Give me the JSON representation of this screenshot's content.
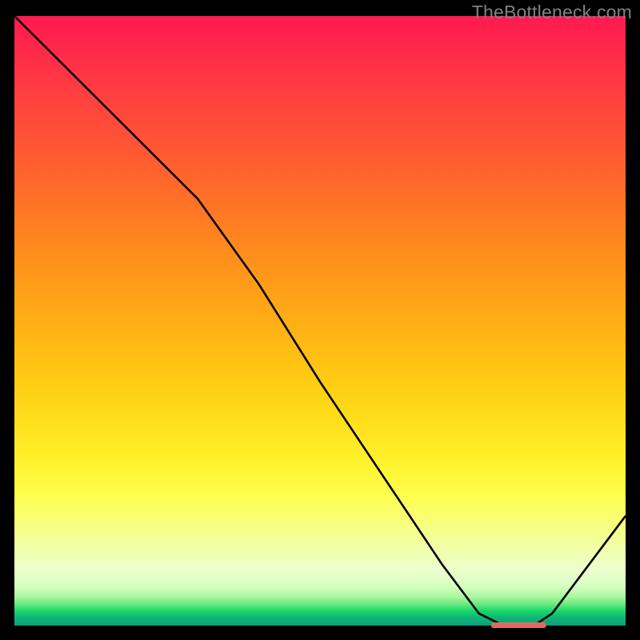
{
  "watermark": "TheBottleneck.com",
  "colors": {
    "gradient_top": "#ff1a4e",
    "gradient_mid": "#ffe01c",
    "gradient_bottom": "#0aa07e",
    "curve": "#000000",
    "optimal_marker": "#de6c5e"
  },
  "chart_data": {
    "type": "line",
    "title": "",
    "xlabel": "",
    "ylabel": "",
    "xlim": [
      0,
      100
    ],
    "ylim": [
      0,
      100
    ],
    "grid": false,
    "legend": false,
    "series": [
      {
        "name": "bottleneck-curve",
        "x": [
          0,
          12,
          24,
          30,
          40,
          50,
          60,
          70,
          76,
          80,
          85,
          88,
          100
        ],
        "y": [
          100,
          88,
          76,
          70,
          56,
          40,
          25,
          10,
          2,
          0,
          0,
          2,
          18
        ]
      }
    ],
    "annotations": [
      {
        "name": "optimal-range",
        "x_start": 78,
        "x_end": 87,
        "y": 0
      }
    ]
  }
}
